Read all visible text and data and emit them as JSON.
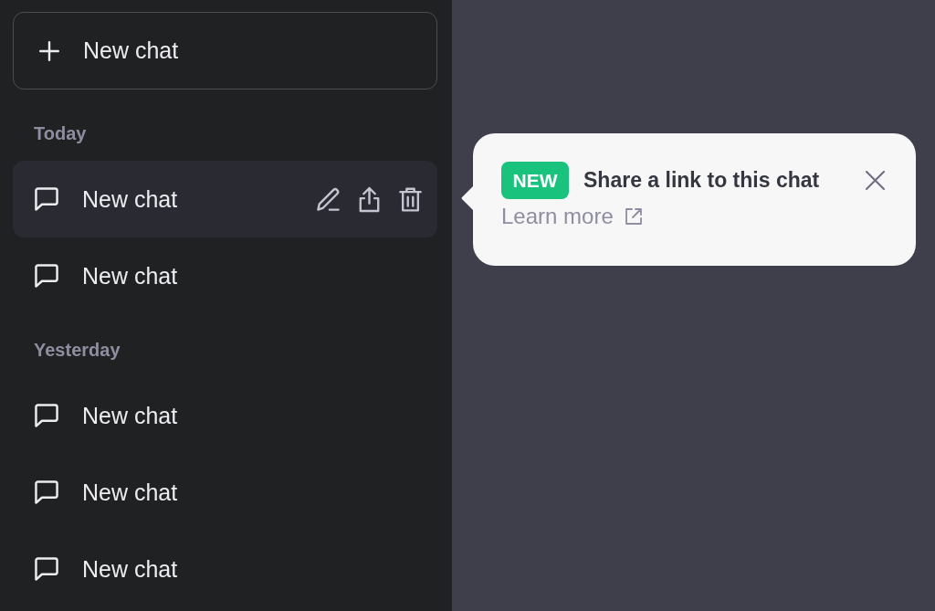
{
  "sidebar": {
    "new_chat_button": {
      "label": "New chat"
    },
    "groups": [
      {
        "heading": "Today",
        "items": [
          {
            "label": "New chat",
            "selected": true
          },
          {
            "label": "New chat",
            "selected": false
          }
        ]
      },
      {
        "heading": "Yesterday",
        "items": [
          {
            "label": "New chat",
            "selected": false
          },
          {
            "label": "New chat",
            "selected": false
          },
          {
            "label": "New chat",
            "selected": false
          }
        ]
      }
    ]
  },
  "popover": {
    "badge": "NEW",
    "title": "Share a link to this chat",
    "link": "Learn more"
  }
}
